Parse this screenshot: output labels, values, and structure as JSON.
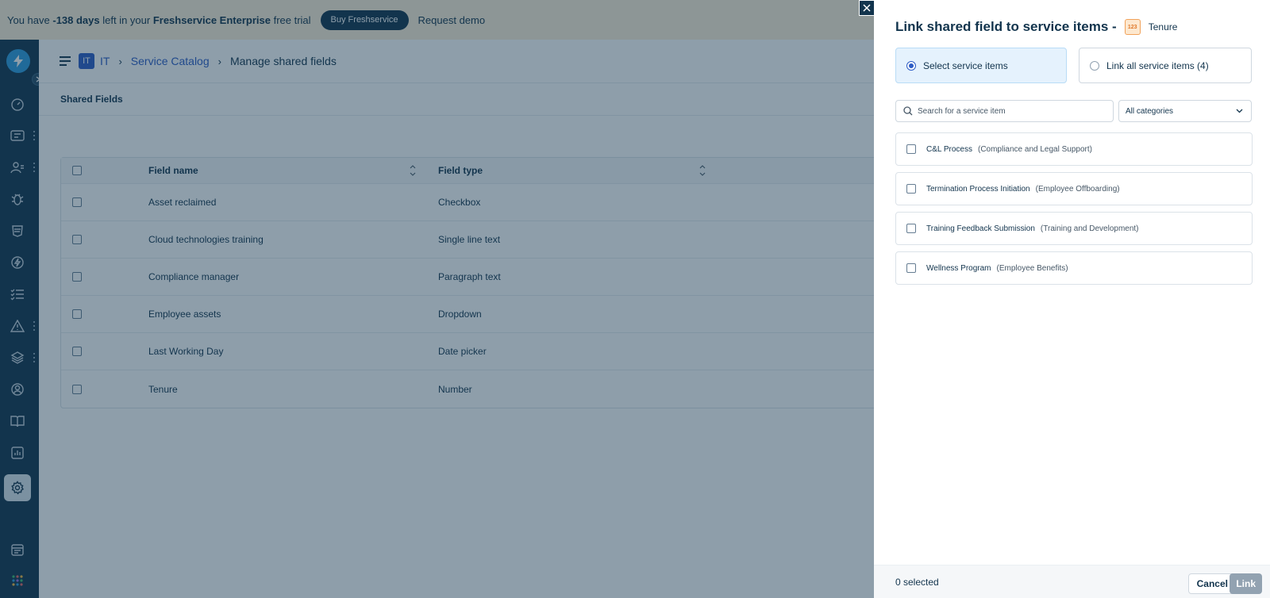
{
  "banner": {
    "prefix": "You have ",
    "days": "-138 days",
    "middle": " left in your ",
    "product": "Freshservice Enterprise",
    "suffix": " free trial",
    "buy_label": "Buy Freshservice",
    "demo_label": "Request demo"
  },
  "breadcrumb": {
    "workspace_badge": "IT",
    "workspace": "IT",
    "catalog": "Service Catalog",
    "current": "Manage shared fields"
  },
  "subtab": "Shared Fields",
  "table": {
    "headers": {
      "name": "Field name",
      "type": "Field type"
    },
    "rows": [
      {
        "name": "Asset reclaimed",
        "type": "Checkbox"
      },
      {
        "name": "Cloud technologies training",
        "type": "Single line text"
      },
      {
        "name": "Compliance manager",
        "type": "Paragraph text"
      },
      {
        "name": "Employee assets",
        "type": "Dropdown"
      },
      {
        "name": "Last Working Day",
        "type": "Date picker"
      },
      {
        "name": "Tenure",
        "type": "Number"
      }
    ]
  },
  "drawer": {
    "title": "Link shared field to service items -",
    "field_icon": "123",
    "field_name": "Tenure",
    "options": {
      "select": "Select service items",
      "all": "Link all service items (4)"
    },
    "search_placeholder": "Search for a service item",
    "category_selected": "All categories",
    "items": [
      {
        "name": "C&L Process",
        "category": "(Compliance and Legal Support)"
      },
      {
        "name": "Termination Process Initiation",
        "category": "(Employee Offboarding)"
      },
      {
        "name": "Training Feedback Submission",
        "category": "(Training and Development)"
      },
      {
        "name": "Wellness Program",
        "category": "(Employee Benefits)"
      }
    ],
    "selected_count": "0 selected",
    "cancel_label": "Cancel",
    "link_label": "Link"
  },
  "colors": {
    "brand_blue": "#2c5cc5",
    "nav_dark": "#12344d",
    "overlay": "rgba(18,52,77,0.48)"
  }
}
